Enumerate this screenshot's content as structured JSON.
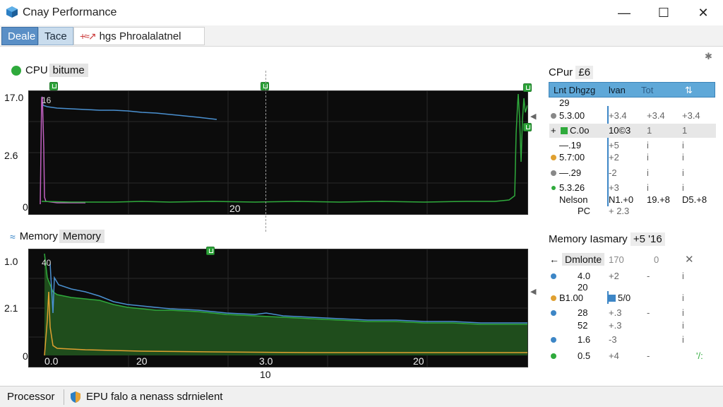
{
  "window": {
    "title": "Cnay Performance",
    "minimize": "—",
    "maximize": "☐",
    "close": "✕"
  },
  "tabs": [
    {
      "label": "Deale"
    },
    {
      "label": "Tace"
    },
    {
      "label": "hgs Phroalalatnel"
    }
  ],
  "cpu": {
    "label": "CPU",
    "label_hl": "bitume",
    "y_ticks": [
      "17.0",
      "2.6",
      "0"
    ],
    "top_left_note": "16",
    "x_mid_label": "20",
    "right_panel": {
      "title": "CPur",
      "title_hl": "£6",
      "header": [
        "Lnt Dhgzg",
        "lvan",
        "Tot"
      ],
      "rows": [
        {
          "c0": "29",
          "c1": "",
          "c2": "",
          "c3": "",
          "bullet": ""
        },
        {
          "c0": "5.3.00",
          "c1": "+3.4",
          "c2": "+3.4",
          "c3": "+3.4",
          "bullet": "#888888"
        },
        {
          "c0": "C.0o",
          "c1": "10©3",
          "c2": "1",
          "c3": "1",
          "bullet": "",
          "selected": true
        },
        {
          "c0": "—.19",
          "c1": "+5",
          "c2": "i",
          "c3": "i",
          "bullet": ""
        },
        {
          "c0": "5.7:00",
          "c1": "+2",
          "c2": "i",
          "c3": "i",
          "bullet": "#e0a030"
        },
        {
          "c0": "—.29",
          "c1": "-2",
          "c2": "i",
          "c3": "i",
          "bullet": "#888888"
        },
        {
          "c0": "5.3.26",
          "c1": "+3",
          "c2": "i",
          "c3": "i",
          "bullet": "#2faa3c"
        },
        {
          "c0": "Nelson",
          "c1": "N1.+0",
          "c2": "19.+8",
          "c3": "D5.+8",
          "bullet": ""
        },
        {
          "c0": "PC",
          "c1": "+ 2.3",
          "c2": "",
          "c3": "",
          "bullet": ""
        }
      ]
    }
  },
  "memory": {
    "label": "Memory",
    "label_hl": "Memory",
    "y_ticks": [
      "1.0",
      "2.1",
      "0"
    ],
    "top_left_note": "40",
    "x_labels": [
      "0.0",
      "20",
      "3.0",
      "20"
    ],
    "x_below": "10",
    "right_panel": {
      "title": "Memory",
      "title_rest": "Iasmary",
      "title_hl": "+5 '16",
      "header": {
        "c0": "Dmlonte",
        "c1": "170",
        "c2": "0",
        "c3": "✕"
      },
      "rows": [
        {
          "c0": "4.0",
          "c1": "+2",
          "c2": "-",
          "c3": "i",
          "bullet": "#3d86c6"
        },
        {
          "c0": "20",
          "c1": "",
          "c2": "",
          "c3": "",
          "bullet": ""
        },
        {
          "c0": "B1.00",
          "c1": "5/0",
          "c2": "",
          "c3": "i",
          "bullet": "#e0a030"
        },
        {
          "c0": "28",
          "c1": "+.3",
          "c2": "-",
          "c3": "i",
          "bullet": "#3d86c6"
        },
        {
          "c0": "52",
          "c1": "+.3",
          "c2": "",
          "c3": "i",
          "bullet": ""
        },
        {
          "c0": "1.6",
          "c1": "-3",
          "c2": "",
          "c3": "i",
          "bullet": "#3d86c6"
        },
        {
          "c0": "0.5",
          "c1": "+4",
          "c2": "-",
          "c3": "'/:",
          "bullet": "#2faa3c"
        }
      ]
    }
  },
  "status": {
    "left": "Processor",
    "right": "EPU falo a nenass sdrnielent"
  },
  "colors": {
    "cpu_line": "#2faa3c",
    "mem_fill": "#1f4d1c",
    "series_blue": "#4a90d0",
    "series_orange": "#e0a030",
    "series_pink": "#c060c0"
  }
}
